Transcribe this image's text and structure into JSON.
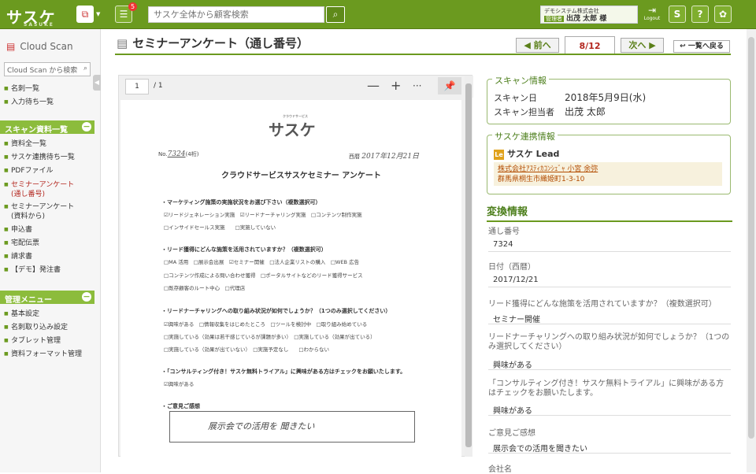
{
  "topbar": {
    "logo": "サスケ",
    "logo_sub": "SASUKE",
    "notification_count": "5",
    "search_placeholder": "サスケ全体から顧客検索",
    "company": "デモシステム株式会社",
    "role": "管理者",
    "user": "出茂 太郎 様",
    "logout": "Logout",
    "colors": {
      "brand": "#6b9a1f",
      "accent": "#b3261e"
    }
  },
  "sidebar": {
    "title": "Cloud Scan",
    "search_placeholder": "Cloud Scan から検索",
    "top_items": [
      "名刺一覧",
      "入力待ち一覧"
    ],
    "section1": "スキャン資料一覧",
    "scan_items": [
      "資料全一覧",
      "サスケ連携待ち一覧",
      "PDFファイル",
      "セミナーアンケート",
      "(通し番号)",
      "セミナーアンケート",
      "(資料から)",
      "申込書",
      "宅配伝票",
      "請求書",
      "【デモ】発注書"
    ],
    "section2": "管理メニュー",
    "admin_items": [
      "基本設定",
      "名刺取り込み設定",
      "タブレット管理",
      "資料フォーマット管理"
    ]
  },
  "header": {
    "title": "セミナーアンケート（通し番号）",
    "prev": "前へ",
    "page": "8/12",
    "next": "次へ",
    "back": "一覧へ戻る"
  },
  "viewer": {
    "page_input": "1",
    "page_total": "/ 1",
    "zoom_out": "—",
    "zoom_in": "+",
    "more": "···"
  },
  "document": {
    "logo": "サスケ",
    "logo_sub": "クラウドサービス",
    "no_label": "No.",
    "no_value": "7324",
    "no_suffix": "(4桁)",
    "date_label": "西暦",
    "date_value": "2017年12月21日",
    "title": "クラウドサービスサスケセミナー アンケート",
    "q1": "・マーケティング施策の実施状況をお選び下さい（複数選択可）",
    "q1_o1": "☑リードジェネレーション実施　☑リードナーチャリング実施　□コンテンツ制作実施",
    "q1_o2": "□インサイドセールス実施　　□実施していない",
    "q2": "・リード獲得にどんな施策を活用されていますか？（複数選択可）",
    "q2_o1": "□MA 活用　□展示会出展　☑セミナー開催　□法人企業リストの購入　□WEB 広告",
    "q2_o2": "□コンテンツ作成による問い合わせ獲得　□ポータルサイトなどのリード獲得サービス",
    "q2_o3": "□既存顧客のルート中心　□代理店",
    "q3": "・リードナーチャリングへの取り組み状況が如何でしょうか？（1つのみ選択してください）",
    "q3_o1": "☑興味がある　□情報収集をはじめたところ　□ツールを検討中　□取り組み始めている",
    "q3_o2": "□実施している（効果は若干感じているが課題が多い）　□実施している（効果が出ている）",
    "q3_o3": "□実施している（効果が出ていない）　□実施予定なし　　□わからない",
    "q4": "・「コンサルティング付き！サスケ無料トライアル」に興味がある方はチェックをお願いたします。",
    "q4_o1": "☑興味がある",
    "q5": "・ご意見ご感想",
    "comment": "展示会での活用を 聞きたい"
  },
  "scan_info": {
    "title": "スキャン情報",
    "date_label": "スキャン日",
    "date_value": "2018年5月9日(水)",
    "owner_label": "スキャン担当者",
    "owner_value": "出茂 太郎"
  },
  "link_info": {
    "title": "サスケ連携情報",
    "icon": "Le",
    "app": "サスケ Lead",
    "company": "株式会社ｱｽﾃｨｶｺﾝｼｪﾞｬ 小宮 余弥",
    "address": "群馬県桐生市織姫町1-3-10"
  },
  "conversion": {
    "title": "変換情報",
    "fields": [
      {
        "label": "通し番号",
        "value": "7324"
      },
      {
        "label": "日付（西暦）",
        "value": "2017/12/21"
      },
      {
        "label": "リード獲得にどんな施策を活用されていますか？（複数選択可）",
        "value": "セミナー開催"
      },
      {
        "label": "リードナーチャリングへの取り組み状況が如何でしょうか？（1つのみ選択してください）",
        "value": "興味がある"
      },
      {
        "label": "「コンサルティング付き！サスケ無料トライアル」に興味がある方はチェックをお願いたします。",
        "value": "興味がある"
      },
      {
        "label": "ご意見ご感想",
        "value": "展示会での活用を聞きたい"
      },
      {
        "label": "会社名",
        "value": ""
      }
    ]
  }
}
